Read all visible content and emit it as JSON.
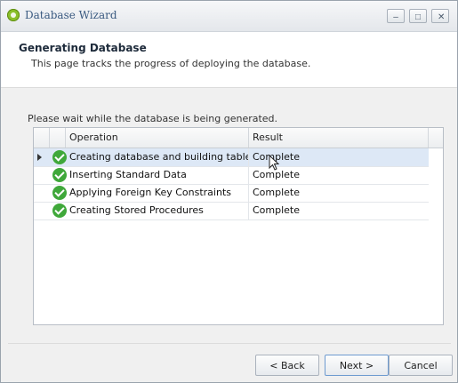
{
  "window": {
    "title": "Database Wizard",
    "controls": {
      "minimize": "–",
      "maximize": "□",
      "close": "✕"
    }
  },
  "header": {
    "title": "Generating Database",
    "subtitle": "This page tracks the progress of deploying the database."
  },
  "status_prompt": "Please wait while the database is being generated.",
  "table": {
    "columns": [
      "Operation",
      "Result"
    ],
    "rows": [
      {
        "operation": "Creating database and building tables",
        "result": "Complete",
        "status": "complete",
        "selected": true
      },
      {
        "operation": "Inserting Standard Data",
        "result": "Complete",
        "status": "complete",
        "selected": false
      },
      {
        "operation": "Applying Foreign Key Constraints",
        "result": "Complete",
        "status": "complete",
        "selected": false
      },
      {
        "operation": "Creating Stored Procedures",
        "result": "Complete",
        "status": "complete",
        "selected": false
      }
    ]
  },
  "buttons": {
    "back": "< Back",
    "next": "Next >",
    "cancel": "Cancel"
  },
  "icons": {
    "app": "app-logo-icon",
    "row_status": "check-circle-icon",
    "row_indicator": "row-pointer-icon"
  },
  "colors": {
    "accent": "#3a5a80",
    "success": "#3fa83a",
    "selection": "#dde8f6"
  }
}
